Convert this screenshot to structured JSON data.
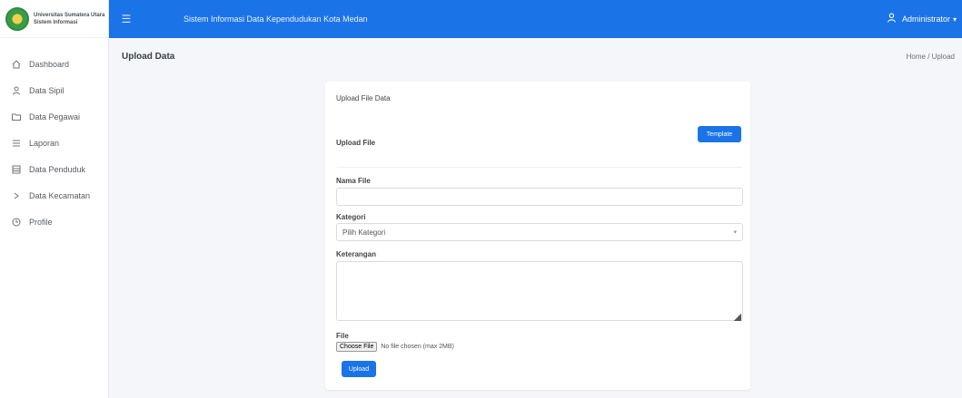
{
  "brand": {
    "name": "Universitas Sumatera Utara",
    "subtitle": "Sistem Informasi"
  },
  "sidebar": {
    "items": [
      {
        "label": "Dashboard",
        "icon": "home-icon"
      },
      {
        "label": "Data Sipil",
        "icon": "user-icon"
      },
      {
        "label": "Data Pegawai",
        "icon": "folder-icon"
      },
      {
        "label": "Laporan",
        "icon": "list-icon"
      },
      {
        "label": "Data Penduduk",
        "icon": "table-icon"
      },
      {
        "label": "Data Kecamatan",
        "icon": "chevron-icon"
      },
      {
        "label": "Profile",
        "icon": "clock-icon"
      }
    ]
  },
  "topbar": {
    "title": "Sistem Informasi Data Kependudukan Kota Medan",
    "user_name": "Administrator"
  },
  "page": {
    "title": "Upload Data",
    "breadcrumb": "Home / Upload"
  },
  "form": {
    "heading": "Upload File Data",
    "template_button": "Template",
    "file_label": "Upload File",
    "name_label": "Nama File",
    "name_value": "",
    "category_label": "Kategori",
    "category_selected": "Pilih Kategori",
    "description_label": "Keterangan",
    "description_value": "",
    "attachment_label": "File",
    "choose_file_button": "Choose File",
    "no_file_text": "No file chosen (max 2MB)",
    "submit_button": "Upload"
  },
  "colors": {
    "primary": "#1b73e8",
    "sidebar_bg": "#ffffff",
    "page_bg": "#f4f6f9"
  }
}
